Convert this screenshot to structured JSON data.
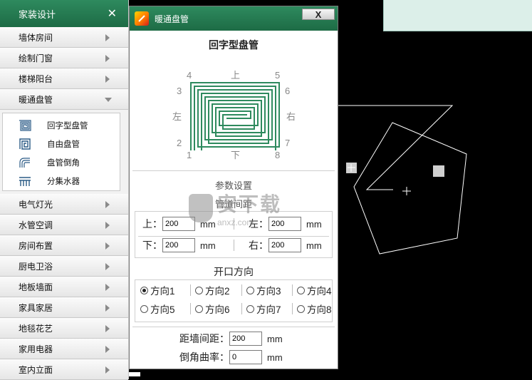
{
  "sidebar": {
    "title": "家装设计",
    "close": "✕",
    "items_top": [
      {
        "label": "墙体房间"
      },
      {
        "label": "绘制门窗"
      },
      {
        "label": "楼梯阳台"
      },
      {
        "label": "暖通盘管"
      }
    ],
    "sub_items": [
      {
        "label": "回字型盘管",
        "icon": "square-spiral-coil-icon"
      },
      {
        "label": "自由盘管",
        "icon": "free-coil-icon"
      },
      {
        "label": "盘管倒角",
        "icon": "coil-fillet-icon"
      },
      {
        "label": "分集水器",
        "icon": "manifold-icon"
      }
    ],
    "items_bottom": [
      {
        "label": "电气灯光"
      },
      {
        "label": "水管空调"
      },
      {
        "label": "房间布置"
      },
      {
        "label": "厨电卫浴"
      },
      {
        "label": "地板墙面"
      },
      {
        "label": "家具家居"
      },
      {
        "label": "地毯花艺"
      },
      {
        "label": "家用电器"
      },
      {
        "label": "室内立面"
      }
    ]
  },
  "dialog": {
    "title": "暖通盘管",
    "close": "X",
    "coil_title": "回字型盘管",
    "diagram": {
      "top": "上",
      "bottom": "下",
      "left": "左",
      "right": "右",
      "n1": "1",
      "n2": "2",
      "n3": "3",
      "n4": "4",
      "n5": "5",
      "n6": "6",
      "n7": "7",
      "n8": "8",
      "coil_color": "#2e8a5e"
    },
    "param_title": "参数设置",
    "spacing_title": "管道间距",
    "spacing": {
      "top_label": "上：",
      "top_value": "200",
      "left_label": "左：",
      "left_value": "200",
      "bottom_label": "下：",
      "bottom_value": "200",
      "right_label": "右：",
      "right_value": "200",
      "unit": "mm"
    },
    "opening_title": "开口方向",
    "directions": [
      {
        "label": "方向1",
        "selected": true
      },
      {
        "label": "方向2",
        "selected": false
      },
      {
        "label": "方向3",
        "selected": false
      },
      {
        "label": "方向4",
        "selected": false
      },
      {
        "label": "方向5",
        "selected": false
      },
      {
        "label": "方向6",
        "selected": false
      },
      {
        "label": "方向7",
        "selected": false
      },
      {
        "label": "方向8",
        "selected": false
      }
    ],
    "wall_distance": {
      "label": "距墙间距：",
      "value": "200",
      "unit": "mm"
    },
    "fillet_radius": {
      "label": "倒角曲率：",
      "value": "0",
      "unit": "mm"
    }
  },
  "watermark": {
    "text": "安下载",
    "subtext": "anxz.com"
  },
  "colors": {
    "accent": "#2e8a5e",
    "canvas_bg": "#000000",
    "cad_lines": "#ffffff"
  }
}
